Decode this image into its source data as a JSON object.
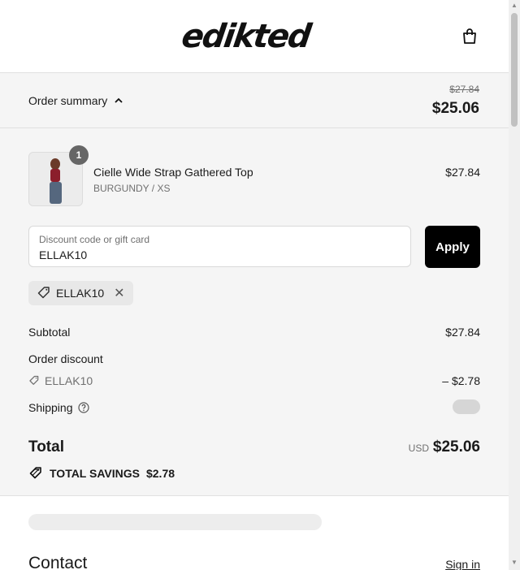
{
  "header": {
    "logo_text": "edikted",
    "cart_icon": "bag-icon"
  },
  "summary": {
    "toggle_label": "Order summary",
    "original_total": "$27.84",
    "total": "$25.06"
  },
  "line_item": {
    "quantity": "1",
    "name": "Cielle Wide Strap Gathered Top",
    "variant": "BURGUNDY / XS",
    "price": "$27.84"
  },
  "discount": {
    "placeholder": "Discount code or gift card",
    "value": "ELLAK10",
    "apply_label": "Apply",
    "applied_code": "ELLAK10"
  },
  "totals": {
    "subtotal_label": "Subtotal",
    "subtotal_value": "$27.84",
    "order_discount_label": "Order discount",
    "discount_code": "ELLAK10",
    "discount_value": "– $2.78",
    "shipping_label": "Shipping",
    "total_label": "Total",
    "currency": "USD",
    "total_value": "$25.06",
    "savings_label": "TOTAL SAVINGS",
    "savings_value": "$2.78"
  },
  "contact": {
    "title": "Contact",
    "signin_label": "Sign in"
  }
}
